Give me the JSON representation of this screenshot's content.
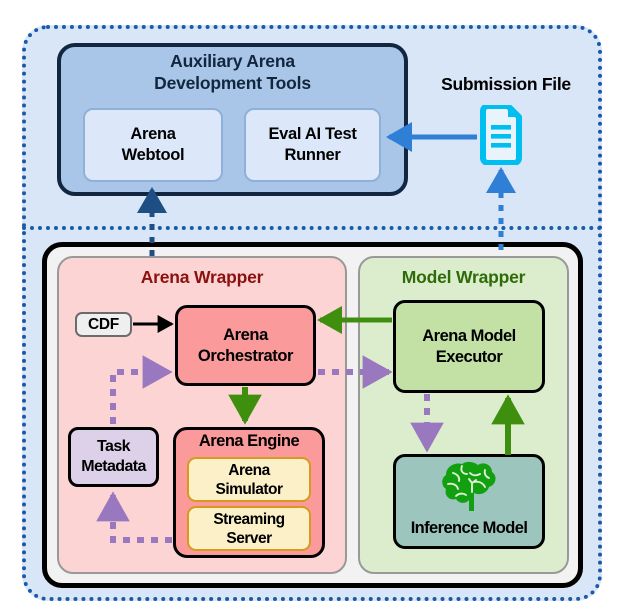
{
  "diagram": {
    "title_implicit": "Arena system architecture",
    "top_section": {
      "aux_tools": {
        "title": "Auxiliary Arena\nDevelopment Tools",
        "title_line1": "Auxiliary Arena",
        "title_line2": "Development Tools",
        "children": [
          {
            "id": "arena-webtool",
            "label_line1": "Arena",
            "label_line2": "Webtool"
          },
          {
            "id": "evalai-test-runner",
            "label_line1": "Eval AI Test",
            "label_line2": "Runner"
          }
        ]
      },
      "submission_file": {
        "label": "Submission File",
        "icon": "document-file-icon",
        "icon_color": "#00bff0"
      }
    },
    "bottom_section": {
      "arena_wrapper": {
        "title": "Arena Wrapper",
        "title_color": "#8b1010",
        "fill": "#fcd4d4",
        "nodes": [
          {
            "id": "cdf",
            "label": "CDF",
            "fill": "#efefef"
          },
          {
            "id": "arena-orchestrator",
            "label_line1": "Arena",
            "label_line2": "Orchestrator",
            "fill": "#fa9a9a"
          },
          {
            "id": "task-metadata",
            "label_line1": "Task",
            "label_line2": "Metadata",
            "fill": "#ddd1e9"
          },
          {
            "id": "arena-engine",
            "title": "Arena Engine",
            "fill": "#fa9a9a",
            "children": [
              {
                "id": "arena-simulator",
                "label_line1": "Arena",
                "label_line2": "Simulator",
                "fill": "#fbf0c8"
              },
              {
                "id": "streaming-server",
                "label_line1": "Streaming",
                "label_line2": "Server",
                "fill": "#fbf0c8"
              }
            ]
          }
        ]
      },
      "model_wrapper": {
        "title": "Model Wrapper",
        "title_color": "#2e6b09",
        "fill": "#dcedcd",
        "nodes": [
          {
            "id": "arena-model-executor",
            "label_line1": "Arena Model",
            "label_line2": "Executor",
            "fill": "#c3e0a5"
          },
          {
            "id": "inference-model",
            "label": "Inference Model",
            "icon": "brain-icon",
            "icon_color": "#12a011",
            "fill": "#9cc6bd"
          }
        ]
      }
    },
    "colors": {
      "outer_dotted_border": "#1a5ba8",
      "outer_fill": "#d9e6f7",
      "aux_box_fill": "#a9c6e8",
      "aux_box_border": "#12263f",
      "submission_cyan": "#00bff0",
      "solid_green_arrow": "#3f8f0f",
      "dotted_purple_arrow": "#9a78bf",
      "blue_arrow": "#2f7fd6",
      "navy_arrow": "#1f4e85"
    },
    "edges": [
      {
        "from": "submission-file",
        "to": "evalai-test-runner",
        "style": "solid",
        "color": "#2f7fd6"
      },
      {
        "from": "arena-webtool",
        "to": "arena-wrapper",
        "style": "dotted",
        "color": "#1f4e85",
        "direction": "up"
      },
      {
        "from": "submission-file",
        "to": "model-wrapper",
        "style": "dotted",
        "color": "#2f7fd6",
        "direction": "up"
      },
      {
        "from": "cdf",
        "to": "arena-orchestrator",
        "style": "solid",
        "color": "#000000"
      },
      {
        "from": "task-metadata",
        "to": "arena-orchestrator",
        "style": "dotted",
        "color": "#9a78bf"
      },
      {
        "from": "arena-engine",
        "to": "task-metadata",
        "style": "dotted",
        "color": "#9a78bf"
      },
      {
        "from": "arena-orchestrator",
        "to": "arena-engine",
        "style": "solid",
        "color": "#3f8f0f"
      },
      {
        "from": "arena-model-executor",
        "to": "arena-orchestrator",
        "style": "solid",
        "color": "#3f8f0f"
      },
      {
        "from": "arena-orchestrator",
        "to": "arena-model-executor",
        "style": "dotted",
        "color": "#9a78bf"
      },
      {
        "from": "arena-model-executor",
        "to": "inference-model",
        "style": "dotted",
        "color": "#9a78bf"
      },
      {
        "from": "inference-model",
        "to": "arena-model-executor",
        "style": "solid",
        "color": "#3f8f0f"
      }
    ]
  }
}
